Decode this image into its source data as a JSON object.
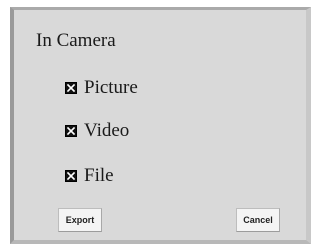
{
  "dialog": {
    "title": "In Camera",
    "options": [
      {
        "label": "Picture",
        "checked": true
      },
      {
        "label": "Video",
        "checked": true
      },
      {
        "label": "File",
        "checked": true
      }
    ],
    "buttons": {
      "export_label": "Export",
      "cancel_label": "Cancel"
    }
  }
}
